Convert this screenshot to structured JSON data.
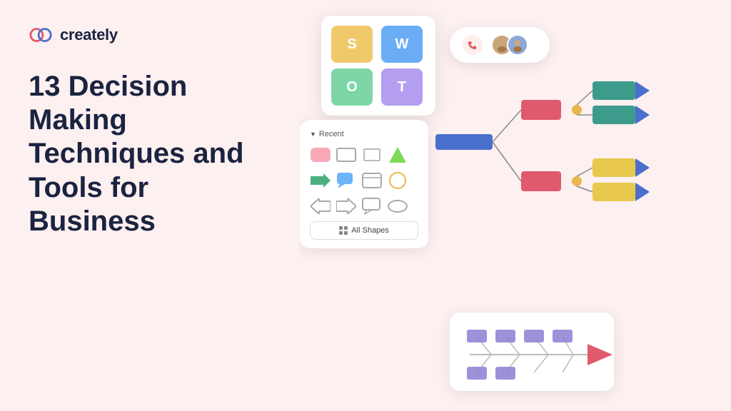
{
  "logo": {
    "text": "creately",
    "icon_name": "creately-logo-icon"
  },
  "headline": {
    "line1": "13 Decision",
    "line2": "Making",
    "line3": "Techniques and",
    "line4": "Tools for",
    "line5": "Business"
  },
  "swot": {
    "cells": [
      {
        "label": "S",
        "color": "#f0c96b",
        "class": "swot-s"
      },
      {
        "label": "W",
        "color": "#6badf5",
        "class": "swot-w"
      },
      {
        "label": "O",
        "color": "#7ed6a7",
        "class": "swot-o"
      },
      {
        "label": "T",
        "color": "#b39ef0",
        "class": "swot-t"
      }
    ]
  },
  "shapes_panel": {
    "recent_label": "Recent",
    "all_shapes_label": "All Shapes"
  },
  "colors": {
    "background": "#fdf0f0",
    "text_dark": "#1a2340",
    "teal": "#3d9b8c",
    "salmon": "#e05a6e",
    "gold": "#e8b84b",
    "yellow": "#e8c84b",
    "blue_arrow": "#4a6fcc",
    "blue_bar": "#4a6fcc",
    "purple_box": "#8b7fd4"
  }
}
